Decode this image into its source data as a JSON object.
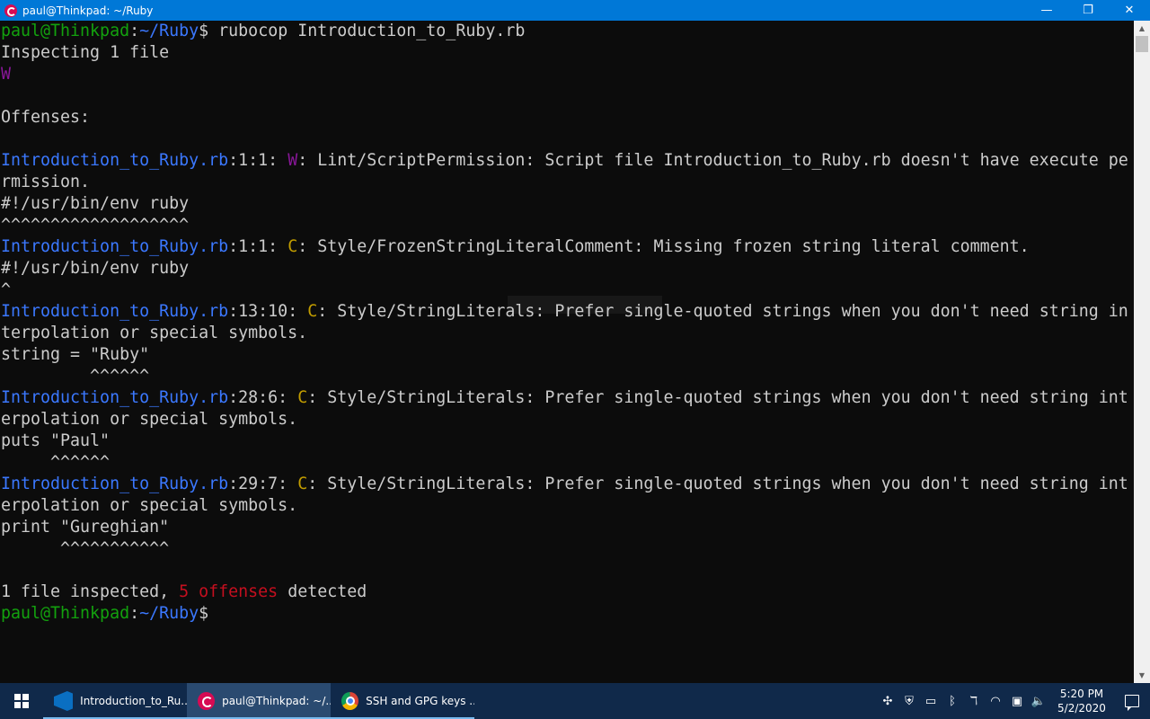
{
  "window": {
    "title": "paul@Thinkpad: ~/Ruby",
    "controls": {
      "minimize": "—",
      "maximize": "❐",
      "close": "✕"
    }
  },
  "terminal": {
    "lines": [
      [
        {
          "t": "paul@Thinkpad",
          "c": "g"
        },
        {
          "t": ":",
          "c": "w"
        },
        {
          "t": "~/Ruby",
          "c": "b"
        },
        {
          "t": "$ rubocop Introduction_to_Ruby.rb",
          "c": "w"
        }
      ],
      [
        {
          "t": "Inspecting 1 file",
          "c": "w"
        }
      ],
      [
        {
          "t": "W",
          "c": "m"
        }
      ],
      [],
      [
        {
          "t": "Offenses:",
          "c": "w"
        }
      ],
      [],
      [
        {
          "t": "Introduction_to_Ruby.rb",
          "c": "b"
        },
        {
          "t": ":1:1: ",
          "c": "w"
        },
        {
          "t": "W",
          "c": "m"
        },
        {
          "t": ": Lint/ScriptPermission: Script file Introduction_to_Ruby.rb doesn't have execute pe",
          "c": "w"
        }
      ],
      [
        {
          "t": "rmission.",
          "c": "w"
        }
      ],
      [
        {
          "t": "#!/usr/bin/env ruby",
          "c": "w"
        }
      ],
      [
        {
          "t": "^^^^^^^^^^^^^^^^^^^",
          "c": "w"
        }
      ],
      [
        {
          "t": "Introduction_to_Ruby.rb",
          "c": "b"
        },
        {
          "t": ":1:1: ",
          "c": "w"
        },
        {
          "t": "C",
          "c": "y"
        },
        {
          "t": ": Style/FrozenStringLiteralComment: Missing frozen string literal comment.",
          "c": "w"
        }
      ],
      [
        {
          "t": "#!/usr/bin/env ruby",
          "c": "w"
        }
      ],
      [
        {
          "t": "^",
          "c": "w"
        }
      ],
      [
        {
          "t": "Introduction_to_Ruby.rb",
          "c": "b"
        },
        {
          "t": ":13:10: ",
          "c": "w"
        },
        {
          "t": "C",
          "c": "y"
        },
        {
          "t": ": Style/StringLiterals: Prefer single-quoted strings when you don't need string in",
          "c": "w"
        }
      ],
      [
        {
          "t": "terpolation or special symbols.",
          "c": "w"
        }
      ],
      [
        {
          "t": "string = \"Ruby\"",
          "c": "w"
        }
      ],
      [
        {
          "t": "         ^^^^^^",
          "c": "w"
        }
      ],
      [
        {
          "t": "Introduction_to_Ruby.rb",
          "c": "b"
        },
        {
          "t": ":28:6: ",
          "c": "w"
        },
        {
          "t": "C",
          "c": "y"
        },
        {
          "t": ": Style/StringLiterals: Prefer single-quoted strings when you don't need string int",
          "c": "w"
        }
      ],
      [
        {
          "t": "erpolation or special symbols.",
          "c": "w"
        }
      ],
      [
        {
          "t": "puts \"Paul\"",
          "c": "w"
        }
      ],
      [
        {
          "t": "     ^^^^^^",
          "c": "w"
        }
      ],
      [
        {
          "t": "Introduction_to_Ruby.rb",
          "c": "b"
        },
        {
          "t": ":29:7: ",
          "c": "w"
        },
        {
          "t": "C",
          "c": "y"
        },
        {
          "t": ": Style/StringLiterals: Prefer single-quoted strings when you don't need string int",
          "c": "w"
        }
      ],
      [
        {
          "t": "erpolation or special symbols.",
          "c": "w"
        }
      ],
      [
        {
          "t": "print \"Gureghian\"",
          "c": "w"
        }
      ],
      [
        {
          "t": "      ^^^^^^^^^^^",
          "c": "w"
        }
      ],
      [],
      [
        {
          "t": "1 file inspected, ",
          "c": "w"
        },
        {
          "t": "5 offenses",
          "c": "r"
        },
        {
          "t": " detected",
          "c": "w"
        }
      ],
      [
        {
          "t": "paul@Thinkpad",
          "c": "g"
        },
        {
          "t": ":",
          "c": "w"
        },
        {
          "t": "~/Ruby",
          "c": "b"
        },
        {
          "t": "$",
          "c": "w"
        }
      ]
    ],
    "line_tops": [
      35,
      59,
      83,
      107,
      131,
      155,
      179,
      203,
      227,
      251,
      275,
      299,
      323,
      347,
      371,
      395,
      419,
      443,
      467,
      491,
      515,
      539,
      563,
      587,
      611,
      635,
      659,
      683
    ]
  },
  "taskbar": {
    "tasks": [
      {
        "label": "Introduction_to_Ru...",
        "icon": "vscode-icon"
      },
      {
        "label": "paul@Thinkpad: ~/...",
        "icon": "debian-icon"
      },
      {
        "label": "SSH and GPG keys ...",
        "icon": "chrome-icon"
      }
    ],
    "tray": [
      "✣",
      "⛨",
      "▭",
      "ᛒ",
      "ℸ",
      "◠",
      "▣",
      "🔈"
    ],
    "clock": {
      "time": "5:20 PM",
      "date": "5/2/2020"
    }
  }
}
